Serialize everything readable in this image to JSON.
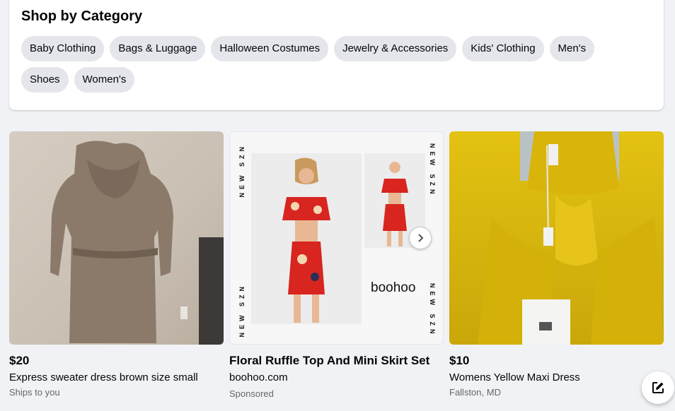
{
  "category_section": {
    "title": "Shop by Category",
    "chips": [
      "Baby Clothing",
      "Bags & Luggage",
      "Halloween Costumes",
      "Jewelry & Accessories",
      "Kids' Clothing",
      "Men's",
      "Shoes",
      "Women's"
    ]
  },
  "listings": [
    {
      "price": "$20",
      "title": "Express sweater dress brown size small",
      "subtitle": "Ships to you"
    },
    {
      "title": "Floral Ruffle Top And Mini Skirt Set",
      "advertiser": "boohoo.com",
      "sponsored_label": "Sponsored",
      "ad_side_text": "NEW SZN",
      "brand_text": "boohoo"
    },
    {
      "price": "$10",
      "title": "Womens Yellow Maxi Dress",
      "subtitle": "Fallston, MD"
    }
  ],
  "icons": {
    "next": "chevron-right-icon",
    "compose": "compose-icon"
  },
  "colors": {
    "page_bg": "#f0f2f5",
    "chip_bg": "#e4e6eb",
    "secondary_text": "#65676b"
  }
}
